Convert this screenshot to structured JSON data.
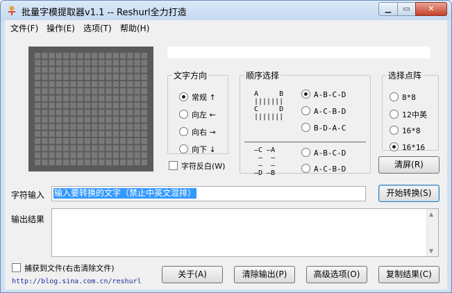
{
  "window": {
    "title": "批量字模提取器v1.1  --  Reshurl全力打造",
    "min_glyph": "▁",
    "max_glyph": "▭",
    "close_glyph": "✕"
  },
  "menu": [
    "文件(F)",
    "操作(E)",
    "选项(T)",
    "帮助(H)"
  ],
  "direction": {
    "legend": "文字方向",
    "options": [
      {
        "label": "常规 ↑",
        "selected": true
      },
      {
        "label": "向左 ←",
        "selected": false
      },
      {
        "label": "向右 →",
        "selected": false
      },
      {
        "label": "向下 ↓",
        "selected": false
      }
    ]
  },
  "order": {
    "legend": "顺序选择",
    "diagram_top": "A     B\n|||||||\nC     D\n|||||||",
    "diagram_bottom": "—C —A\n —  —\n —  —\n—D —B",
    "options_top": [
      {
        "label": "A-B-C-D",
        "selected": true
      },
      {
        "label": "A-C-B-D",
        "selected": false
      },
      {
        "label": "B-D-A-C",
        "selected": false
      }
    ],
    "options_bottom": [
      {
        "label": "A-B-C-D",
        "selected": false
      },
      {
        "label": "A-C-B-D",
        "selected": false
      }
    ]
  },
  "dots": {
    "legend": "选择点阵",
    "options": [
      {
        "label": "8*8",
        "selected": false
      },
      {
        "label": "12中英",
        "selected": false
      },
      {
        "label": "16*8",
        "selected": false
      },
      {
        "label": "16*16",
        "selected": true
      }
    ]
  },
  "invert_label": "字符反白(W)",
  "clear_screen_button": "清屏(R)",
  "char_input": {
    "label": "字符输入",
    "value": "输入要转换的文字（禁止中英文混排）"
  },
  "convert_button": "开始转换(S)",
  "output": {
    "label": "输出结果",
    "value": ""
  },
  "capture_label": "捕获到文件(右击清除文件)",
  "link_text": "http://blog.sina.com.cn/reshurl",
  "buttons": {
    "about": "关于(A)",
    "clear_output": "清除输出(P)",
    "advanced": "高级选项(O)",
    "copy": "复制结果(C)"
  },
  "matrix": {
    "rows": 16,
    "cols": 16,
    "cell_color": "#7a7a7a",
    "bg_color": "#5a5a5a"
  }
}
